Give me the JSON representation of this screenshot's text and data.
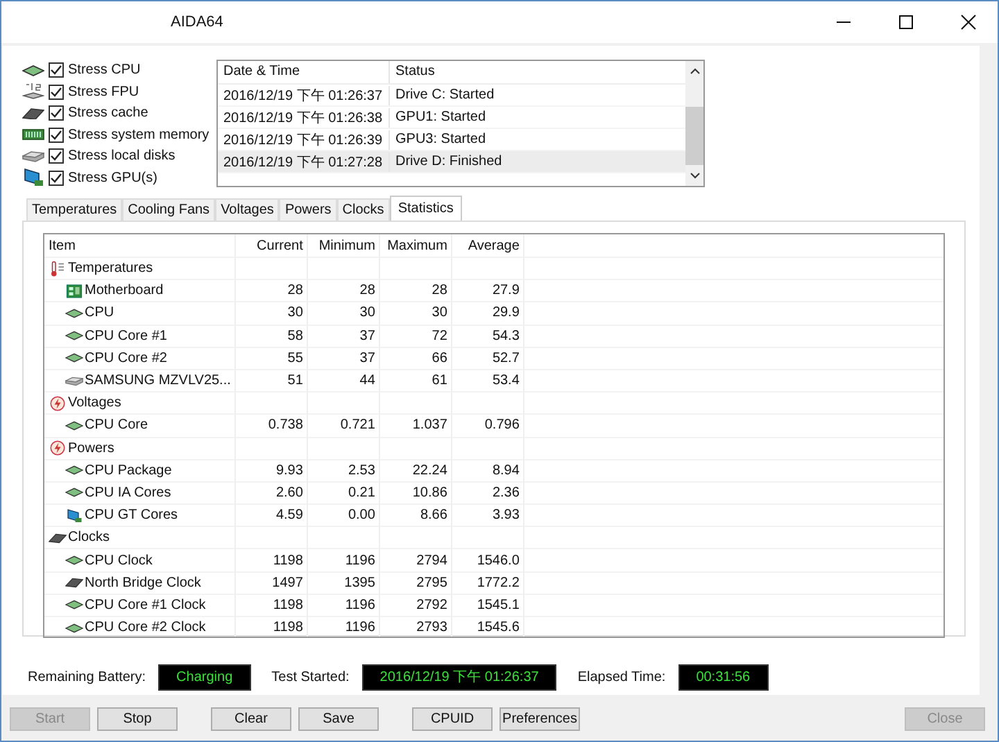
{
  "window": {
    "title": "AIDA64"
  },
  "stress_options": [
    {
      "label": "Stress CPU",
      "checked": true,
      "kind": "chip"
    },
    {
      "label": "Stress FPU",
      "checked": true,
      "kind": "fpu"
    },
    {
      "label": "Stress cache",
      "checked": true,
      "kind": "cache"
    },
    {
      "label": "Stress system memory",
      "checked": true,
      "kind": "memory"
    },
    {
      "label": "Stress local disks",
      "checked": true,
      "kind": "disk"
    },
    {
      "label": "Stress GPU(s)",
      "checked": true,
      "kind": "gpu"
    }
  ],
  "log": {
    "columns": [
      "Date & Time",
      "Status"
    ],
    "rows": [
      {
        "time": "2016/12/19 下午 01:26:37",
        "status": "Drive C: Started",
        "selected": false
      },
      {
        "time": "2016/12/19 下午 01:26:38",
        "status": "GPU1: Started",
        "selected": false
      },
      {
        "time": "2016/12/19 下午 01:26:39",
        "status": "GPU3: Started",
        "selected": false
      },
      {
        "time": "2016/12/19 下午 01:27:28",
        "status": "Drive D: Finished",
        "selected": true
      }
    ]
  },
  "tabs": [
    {
      "label": "Temperatures",
      "selected": false
    },
    {
      "label": "Cooling Fans",
      "selected": false
    },
    {
      "label": "Voltages",
      "selected": false
    },
    {
      "label": "Powers",
      "selected": false
    },
    {
      "label": "Clocks",
      "selected": false
    },
    {
      "label": "Statistics",
      "selected": true
    }
  ],
  "table": {
    "columns": [
      "Item",
      "Current",
      "Minimum",
      "Maximum",
      "Average"
    ],
    "rows": [
      {
        "item": "Temperatures",
        "kind": "thermometer",
        "children": [
          {
            "item": "Motherboard",
            "kind": "board",
            "values": [
              "28",
              "28",
              "28",
              "27.9"
            ]
          },
          {
            "item": "CPU",
            "kind": "chip",
            "values": [
              "30",
              "30",
              "30",
              "29.9"
            ]
          },
          {
            "item": "CPU Core #1",
            "kind": "chip",
            "values": [
              "58",
              "37",
              "72",
              "54.3"
            ]
          },
          {
            "item": "CPU Core #2",
            "kind": "chip",
            "values": [
              "55",
              "37",
              "66",
              "52.7"
            ]
          },
          {
            "item": "SAMSUNG MZVLV25...",
            "kind": "disk",
            "values": [
              "51",
              "44",
              "61",
              "53.4"
            ]
          }
        ]
      },
      {
        "item": "Voltages",
        "kind": "bolt",
        "children": [
          {
            "item": "CPU Core",
            "kind": "chip",
            "values": [
              "0.738",
              "0.721",
              "1.037",
              "0.796"
            ]
          }
        ]
      },
      {
        "item": "Powers",
        "kind": "bolt",
        "children": [
          {
            "item": "CPU Package",
            "kind": "chip",
            "values": [
              "9.93",
              "2.53",
              "22.24",
              "8.94"
            ]
          },
          {
            "item": "CPU IA Cores",
            "kind": "chip",
            "values": [
              "2.60",
              "0.21",
              "10.86",
              "2.36"
            ]
          },
          {
            "item": "CPU GT Cores",
            "kind": "gpu",
            "values": [
              "4.59",
              "0.00",
              "8.66",
              "3.93"
            ]
          }
        ]
      },
      {
        "item": "Clocks",
        "kind": "cache",
        "children": [
          {
            "item": "CPU Clock",
            "kind": "chip",
            "values": [
              "1198",
              "1196",
              "2794",
              "1546.0"
            ]
          },
          {
            "item": "North Bridge Clock",
            "kind": "cache",
            "values": [
              "1497",
              "1395",
              "2795",
              "1772.2"
            ]
          },
          {
            "item": "CPU Core #1 Clock",
            "kind": "chip",
            "values": [
              "1198",
              "1196",
              "2792",
              "1545.1"
            ]
          },
          {
            "item": "CPU Core #2 Clock",
            "kind": "chip",
            "values": [
              "1198",
              "1196",
              "2793",
              "1545.6"
            ]
          }
        ]
      }
    ]
  },
  "status": [
    {
      "label": "Remaining Battery:",
      "value": "Charging"
    },
    {
      "label": "Test Started:",
      "value": "2016/12/19 下午 01:26:37"
    },
    {
      "label": "Elapsed Time:",
      "value": "00:31:56"
    }
  ],
  "buttons": [
    {
      "label": "Start",
      "disabled": true
    },
    {
      "label": "Stop",
      "disabled": false
    },
    {
      "label": "Clear",
      "disabled": false
    },
    {
      "label": "Save",
      "disabled": false
    },
    {
      "label": "CPUID",
      "disabled": false
    },
    {
      "label": "Preferences",
      "disabled": false
    },
    {
      "label": "Close",
      "disabled": true
    }
  ]
}
